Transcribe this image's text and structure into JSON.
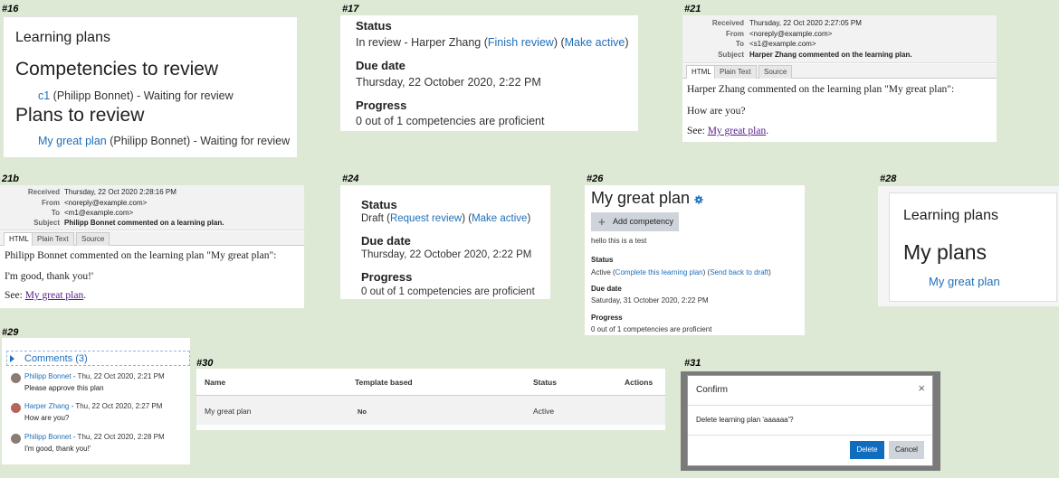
{
  "tags": {
    "t16": "#16",
    "t17": "#17",
    "t21": "#21",
    "t21b": "21b",
    "t24": "#24",
    "t26": "#26",
    "t28": "#28",
    "t29": "#29",
    "t30": "#30",
    "t31": "#31"
  },
  "p16": {
    "title": "Learning plans",
    "comp_heading": "Competencies to review",
    "comp_link": "c1",
    "comp_rest": " (Philipp Bonnet) - Waiting for review",
    "plans_heading": "Plans to review",
    "plan_link": "My great plan",
    "plan_rest": " (Philipp Bonnet) - Waiting for review"
  },
  "p17": {
    "status_label": "Status",
    "status_text": "In review - Harper Zhang (",
    "finish_review": "Finish review",
    "mid": ") (",
    "make_active": "Make active",
    "end": ")",
    "due_label": "Due date",
    "due_value": "Thursday, 22 October 2020, 2:22 PM",
    "progress_label": "Progress",
    "progress_value": "0 out of 1 competencies are proficient"
  },
  "p21": {
    "received_k": "Received",
    "received_v": "Thursday, 22 Oct 2020 2:27:05 PM",
    "from_k": "From",
    "from_v": "<noreply@example.com>",
    "to_k": "To",
    "to_v": "<s1@example.com>",
    "subject_k": "Subject",
    "subject_v": "Harper Zhang commented on the learning plan.",
    "tab_html": "HTML",
    "tab_plain": "Plain Text",
    "tab_source": "Source",
    "line1": "Harper Zhang commented on the learning plan \"My great plan\":",
    "line2": "How are you?",
    "see": "See: ",
    "link": "My great plan",
    "dot": "."
  },
  "p21b": {
    "received_k": "Received",
    "received_v": "Thursday, 22 Oct 2020 2:28:16 PM",
    "from_k": "From",
    "from_v": "<noreply@example.com>",
    "to_k": "To",
    "to_v": "<m1@example.com>",
    "subject_k": "Subject",
    "subject_v": "Philipp Bonnet commented on a learning plan.",
    "tab_html": "HTML",
    "tab_plain": "Plain Text",
    "tab_source": "Source",
    "line1": "Philipp Bonnet commented on the learning plan \"My great plan\":",
    "line2": "I'm good, thank you!'",
    "see": "See: ",
    "link": "My great plan",
    "dot": "."
  },
  "p24": {
    "status_label": "Status",
    "status_text": "Draft (",
    "request_review": "Request review",
    "mid": ") (",
    "make_active": "Make active",
    "end": ")",
    "due_label": "Due date",
    "due_value": "Thursday, 22 October 2020, 2:22 PM",
    "progress_label": "Progress",
    "progress_value": "0 out of 1 competencies are proficient"
  },
  "p26": {
    "title": "My great plan",
    "add_competency": "Add competency",
    "description": "hello this is a test",
    "status_label": "Status",
    "status_pre": "Active (",
    "complete": "Complete this learning plan",
    "mid": ") (",
    "send_back": "Send back to draft",
    "end": ")",
    "due_label": "Due date",
    "due_value": "Saturday, 31 October 2020, 2:22 PM",
    "progress_label": "Progress",
    "progress_value": "0 out of 1 competencies are proficient"
  },
  "p28": {
    "title": "Learning plans",
    "heading": "My plans",
    "link": "My great plan"
  },
  "p29": {
    "toggle": "Comments (3)",
    "comments": [
      {
        "author": "Philipp Bonnet",
        "date": " - Thu, 22 Oct 2020, 2:21 PM",
        "text": "Please approve this plan"
      },
      {
        "author": "Harper Zhang",
        "date": " - Thu, 22 Oct 2020, 2:27 PM",
        "text": "How are you?"
      },
      {
        "author": "Philipp Bonnet",
        "date": " - Thu, 22 Oct 2020, 2:28 PM",
        "text": "I'm good, thank you!'"
      }
    ]
  },
  "p30": {
    "headers": [
      "Name",
      "Template based",
      "Status",
      "Actions"
    ],
    "row": {
      "name": "My great plan",
      "template": "No",
      "status": "Active"
    }
  },
  "p31": {
    "title": "Confirm",
    "close": "×",
    "message": "Delete learning plan 'aaaaaa'?",
    "delete": "Delete",
    "cancel": "Cancel"
  },
  "colors": {
    "link": "#1f6fba",
    "visited": "#551a8b",
    "primary": "#0f6cbf",
    "background": "#dde9d4"
  }
}
